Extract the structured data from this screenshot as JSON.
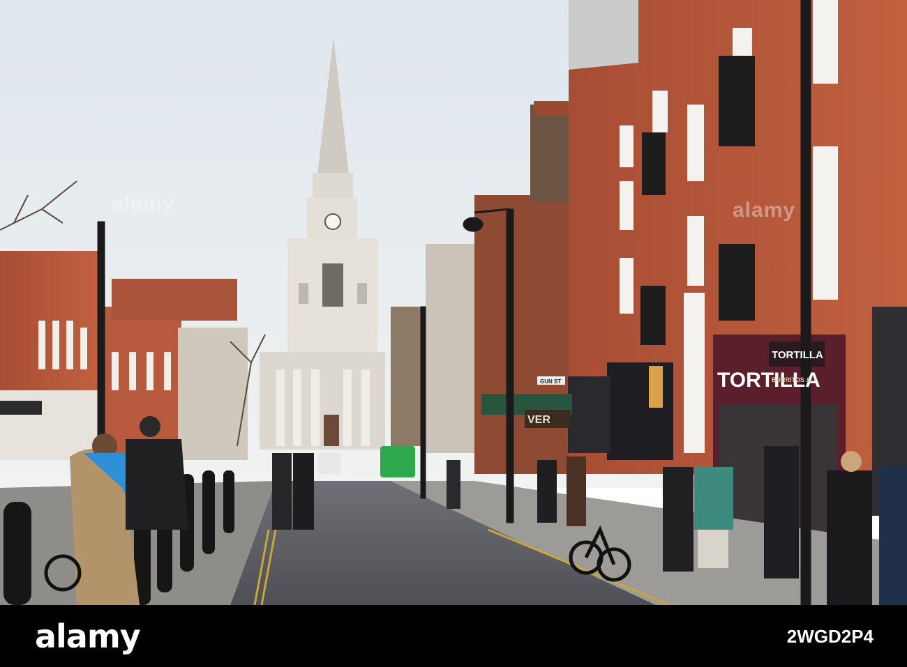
{
  "watermark": {
    "text": "alamy"
  },
  "signs": {
    "tortilla_fascia": "TORTILLA",
    "tortilla_blade": "TORTILLA",
    "tortilla_sub": "BURRITOS &",
    "pub_sign": "VER",
    "street_sign": "GUN ST"
  },
  "footer": {
    "logo": "alamy",
    "image_id": "2WGD2P4"
  },
  "colors": {
    "sky": "#e9eef1",
    "brick": "#b5563c",
    "stone": "#e3e0d9",
    "road": "#5f6066",
    "footer_bg": "#000000"
  }
}
